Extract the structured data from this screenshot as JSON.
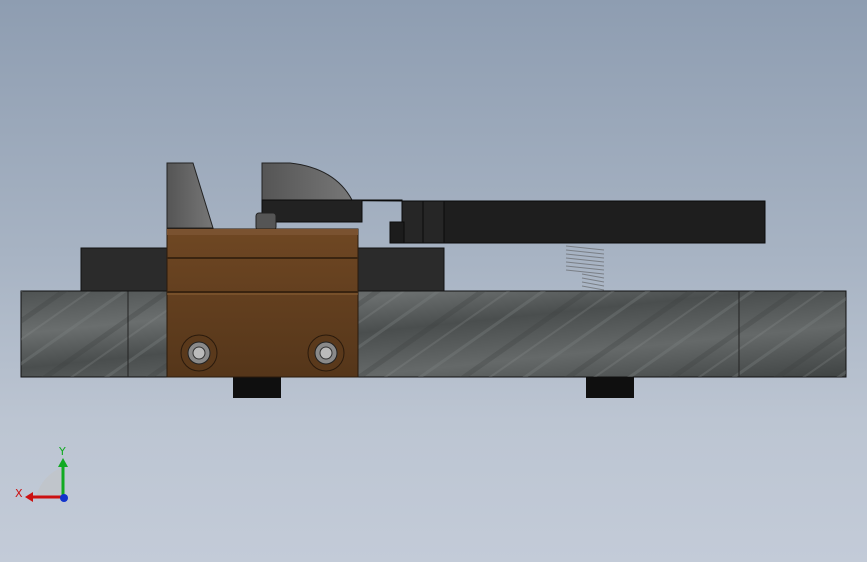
{
  "viewport": {
    "background_top": "#8e9db1",
    "background_bottom": "#c3cbd8"
  },
  "model": {
    "colors": {
      "base_plate": "#5b5f5f",
      "base_plate_dark": "#3e4242",
      "slider_block": "#6b4422",
      "slider_stripe": "#4e3018",
      "jaw": "#6a6a6a",
      "clamp_lever": "#1f1f1f",
      "support_block": "#2b2b2b",
      "foot": "#0f0f0f",
      "outline": "#111111"
    }
  },
  "triad": {
    "x_label": "X",
    "y_label": "Y",
    "x_color": "#cc1111",
    "y_color": "#11aa22",
    "z_color": "#1133cc"
  }
}
